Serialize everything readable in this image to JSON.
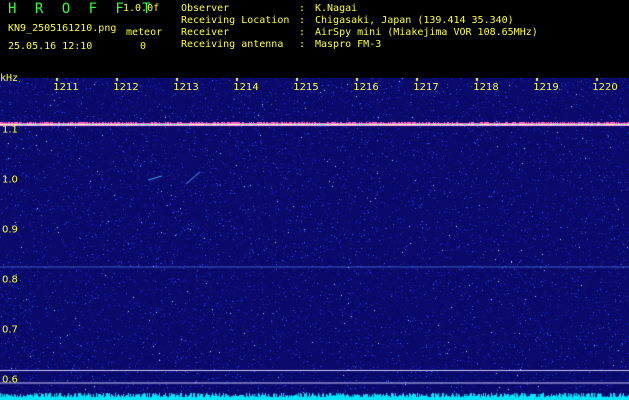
{
  "header": {
    "app_title": "H R O F F T",
    "version": "1.0.0f",
    "filename": "KN9_2505161210.png",
    "mode": "meteor",
    "datetime": "25.05.16 12:10",
    "meteor_count": "0"
  },
  "info": [
    {
      "label": "Observer",
      "sep": ":",
      "value": "K.Nagai"
    },
    {
      "label": "Receiving Location",
      "sep": ":",
      "value": "Chigasaki, Japan (139.414 35.340)"
    },
    {
      "label": "Receiver",
      "sep": ":",
      "value": "AirSpy mini (Miakejima VOR 108.65MHz)"
    },
    {
      "label": "Receiving antenna",
      "sep": ":",
      "value": "Maspro FM-3"
    }
  ],
  "spectrogram": {
    "y_unit": "kHz",
    "x_ticks": [
      "1211",
      "1212",
      "1213",
      "1214",
      "1215",
      "1216",
      "1217",
      "1218",
      "1219",
      "1220"
    ],
    "y_ticks": [
      {
        "label": "1.1",
        "value": 1.1
      },
      {
        "label": "1.0",
        "value": 1.0
      },
      {
        "label": "0.9",
        "value": 0.9
      },
      {
        "label": "0.8",
        "value": 0.8
      },
      {
        "label": "0.7",
        "value": 0.7
      },
      {
        "label": "0.6",
        "value": 0.6
      }
    ],
    "y_range": [
      0.56,
      1.18
    ],
    "carrier_khz": 1.112,
    "faint_line_khz": 0.827,
    "baseline_khz": [
      0.62,
      0.595
    ],
    "colors": {
      "background": "#0a0a6a",
      "noise_dot": "#3a5aff",
      "carrier": "#ff66cc",
      "carrier_core": "#ffffaa",
      "line": "#6699ff",
      "baseline": "#c8c8ff",
      "noise_floor": "#00e5ff",
      "tick_mark": "#ffff22"
    }
  }
}
